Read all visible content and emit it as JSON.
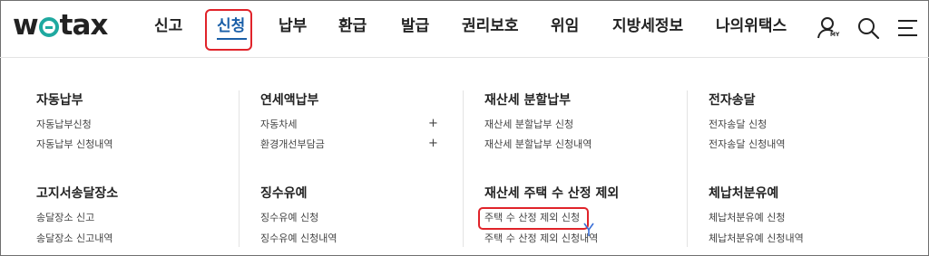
{
  "header": {
    "logo": {
      "part1": "w",
      "part2": "tax"
    },
    "nav": [
      {
        "label": "신고"
      },
      {
        "label": "신청"
      },
      {
        "label": "납부"
      },
      {
        "label": "환급"
      },
      {
        "label": "발급"
      },
      {
        "label": "권리보호"
      },
      {
        "label": "위임"
      },
      {
        "label": "지방세정보"
      },
      {
        "label": "나의위택스"
      }
    ],
    "active_nav": "신청",
    "my_label": "MY",
    "icons": [
      "user-my-icon",
      "search-icon",
      "menu-icon"
    ]
  },
  "menu": {
    "col1": {
      "group1": {
        "title": "자동납부",
        "links": [
          "자동납부신청",
          "자동납부 신청내역"
        ]
      },
      "group2": {
        "title": "고지서송달장소",
        "links": [
          "송달장소 신고",
          "송달장소 신고내역"
        ]
      }
    },
    "col2": {
      "group1": {
        "title": "연세액납부",
        "links": [
          "자동차세",
          "환경개선부담금"
        ],
        "expand": "+"
      },
      "group2": {
        "title": "징수유예",
        "links": [
          "징수유예 신청",
          "징수유예 신청내역"
        ]
      }
    },
    "col3": {
      "group1": {
        "title": "재산세 분할납부",
        "links": [
          "재산세 분할납부 신청",
          "재산세 분할납부 신청내역"
        ]
      },
      "group2": {
        "title": "재산세 주택 수 산정 제외",
        "links": [
          "주택 수 산정 제외 신청",
          "주택 수 산정 제외 신청내역"
        ]
      }
    },
    "col4": {
      "group1": {
        "title": "전자송달",
        "links": [
          "전자송달 신청",
          "전자송달 신청내역"
        ]
      },
      "group2": {
        "title": "체납처분유예",
        "links": [
          "체납처분유예 신청",
          "체납처분유예 신청내역"
        ]
      }
    }
  },
  "colors": {
    "accent": "#1a5fa8",
    "logo_ring": "#1fa9a0",
    "highlight": "#e0232a"
  }
}
